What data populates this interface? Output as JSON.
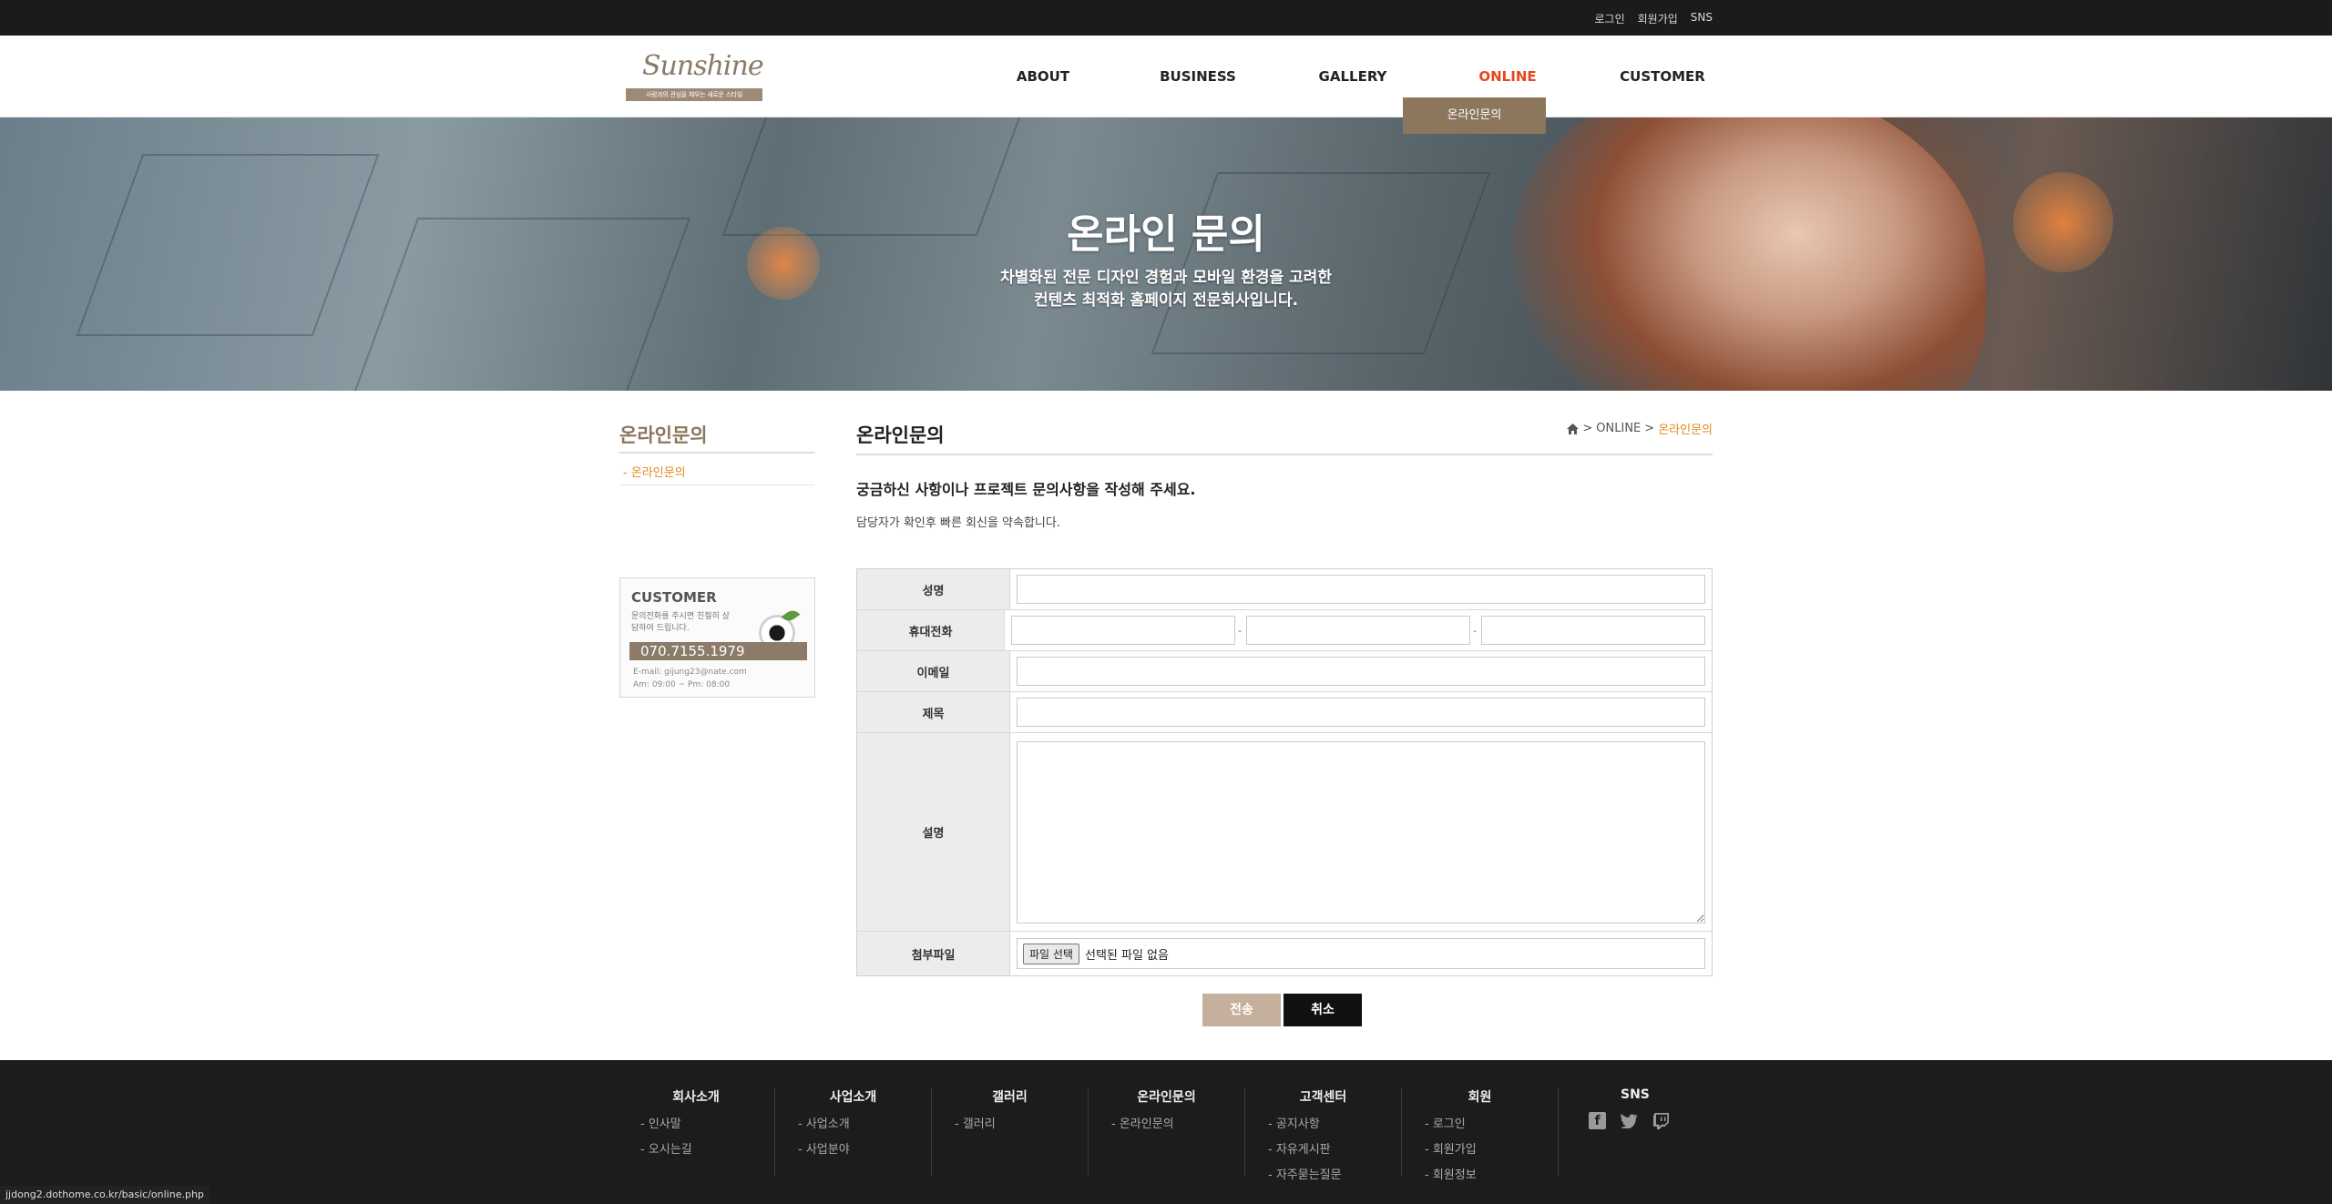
{
  "topbar": {
    "links": [
      "로그인",
      "회원가입",
      "SNS"
    ]
  },
  "logo": {
    "script": "Sunshine",
    "tagline": "사람과의 관심을 채우는 새로운 스타일"
  },
  "nav": {
    "items": [
      "ABOUT",
      "BUSINESS",
      "GALLERY",
      "ONLINE",
      "CUSTOMER"
    ],
    "active_index": 3,
    "submenu": "온라인문의"
  },
  "hero": {
    "title": "온라인 문의",
    "line1": "차별화된 전문 디자인 경험과 모바일 환경을 고려한",
    "line2": "컨텐츠 최적화 홈페이지 전문회사입니다."
  },
  "sidebar": {
    "title": "온라인문의",
    "item": "- 온라인문의",
    "customer": {
      "title": "CUSTOMER",
      "desc": "문의전화를 주시면 친절히 상담하여 드립니다.",
      "phone": "070.7155.1979",
      "email": "E-mail: gijung23@nate.com",
      "hours": "Am: 09:00 ~ Pm: 08:00"
    }
  },
  "content": {
    "title": "온라인문의",
    "breadcrumb": {
      "sep1": ">",
      "section": "ONLINE",
      "sep2": ">",
      "current": "온라인문의"
    },
    "lead": "궁금하신 사항이나 프로젝트 문의사항을 작성해 주세요.",
    "sub": "담당자가 확인후 빠른 회신을 약속합니다."
  },
  "form": {
    "name_label": "성명",
    "phone_label": "휴대전화",
    "phone_dash": "-",
    "email_label": "이메일",
    "subject_label": "제목",
    "desc_label": "설명",
    "file_label": "첨부파일",
    "file_button": "파일 선택",
    "file_status": "선택된 파일 없음"
  },
  "buttons": {
    "send": "전송",
    "cancel": "취소"
  },
  "footer": {
    "columns": [
      {
        "title": "회사소개",
        "links": [
          "- 인사말",
          "- 오시는길"
        ]
      },
      {
        "title": "사업소개",
        "links": [
          "- 사업소개",
          "- 사업분야"
        ]
      },
      {
        "title": "갤러리",
        "links": [
          "- 갤러리"
        ]
      },
      {
        "title": "온라인문의",
        "links": [
          "- 온라인문의"
        ]
      },
      {
        "title": "고객센터",
        "links": [
          "- 공지사항",
          "- 자유게시판",
          "- 자주묻는질문"
        ]
      },
      {
        "title": "회원",
        "links": [
          "- 로그인",
          "- 회원가입",
          "- 회원정보"
        ]
      }
    ],
    "sns_title": "SNS",
    "sns_icons": [
      "facebook-icon",
      "twitter-icon",
      "twitch-icon"
    ]
  },
  "status_url": "jjdong2.dothome.co.kr/basic/online.php",
  "colors": {
    "accent": "#e08a1e",
    "nav_active": "#e5481f",
    "brown": "#8c765c",
    "topbar": "#1b1b1b",
    "footer": "#1c1c1c"
  }
}
